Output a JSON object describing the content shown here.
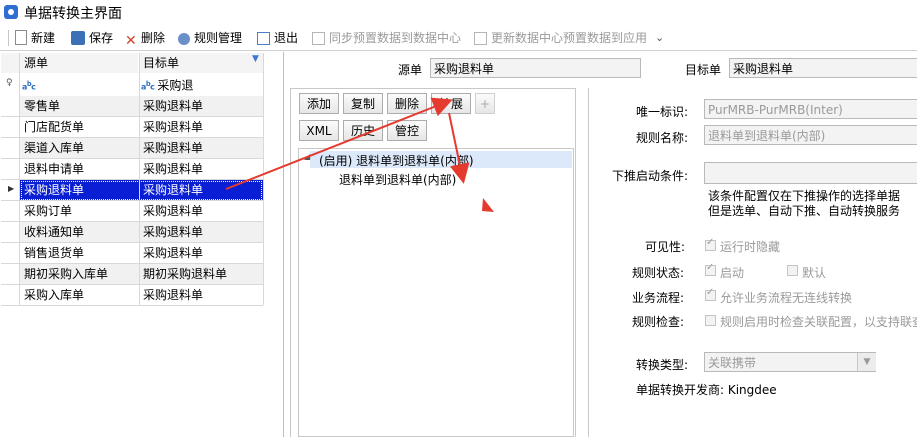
{
  "window": {
    "title": "单据转换主界面"
  },
  "toolbar": {
    "new": "新建",
    "save": "保存",
    "delete": "删除",
    "rule_mgmt": "规则管理",
    "exit": "退出",
    "sync_preset": "同步预置数据到数据中心",
    "update_preset": "更新数据中心预置数据到应用"
  },
  "grid": {
    "col_source": "源单",
    "col_target": "目标单",
    "filter_target": "采购退",
    "rows": [
      {
        "source": "零售单",
        "target": "采购退料单"
      },
      {
        "source": "门店配货单",
        "target": "采购退料单"
      },
      {
        "source": "渠道入库单",
        "target": "采购退料单"
      },
      {
        "source": "退料申请单",
        "target": "采购退料单"
      },
      {
        "source": "采购退料单",
        "target": "采购退料单"
      },
      {
        "source": "采购订单",
        "target": "采购退料单"
      },
      {
        "source": "收料通知单",
        "target": "采购退料单"
      },
      {
        "source": "销售退货单",
        "target": "采购退料单"
      },
      {
        "source": "期初采购入库单",
        "target": "期初采购退料单"
      },
      {
        "source": "采购入库单",
        "target": "采购退料单"
      }
    ],
    "selected_index": 4
  },
  "header": {
    "source_label": "源单",
    "source_value": "采购退料单",
    "target_label": "目标单",
    "target_value": "采购退料单"
  },
  "rule_buttons": {
    "add": "添加",
    "copy": "复制",
    "delete": "删除",
    "extend": "扩展",
    "plus": "+",
    "xml": "XML",
    "history": "历史",
    "control": "管控"
  },
  "tree": {
    "parent": "(启用) 退料单到退料单(内部)",
    "child": "退料单到退料单(内部)"
  },
  "props": {
    "unique_id_label": "唯一标识:",
    "unique_id_value": "PurMRB-PurMRB(Inter)",
    "rule_name_label": "规则名称:",
    "rule_name_value": "退料单到退料单(内部)",
    "push_cond_label": "下推启动条件:",
    "push_note_1": "该条件配置仅在下推操作的选择单据",
    "push_note_2": "但是选单、自动下推、自动转换服务",
    "visibility_label": "可见性:",
    "visibility_opt": "运行时隐藏",
    "status_label": "规则状态:",
    "status_opt_enable": "启动",
    "status_opt_default": "默认",
    "flow_label": "业务流程:",
    "flow_opt": "允许业务流程无连线转换",
    "check_label": "规则检查:",
    "check_opt": "规则启用时检查关联配置，以支持联查",
    "convert_type_label": "转换类型:",
    "convert_type_value": "关联携带",
    "developer_text": "单据转换开发商: Kingdee"
  },
  "colors": {
    "selection": "#0a1fd4",
    "arrow": "#e53a2e",
    "tree_highlight": "#dbe9fb"
  }
}
